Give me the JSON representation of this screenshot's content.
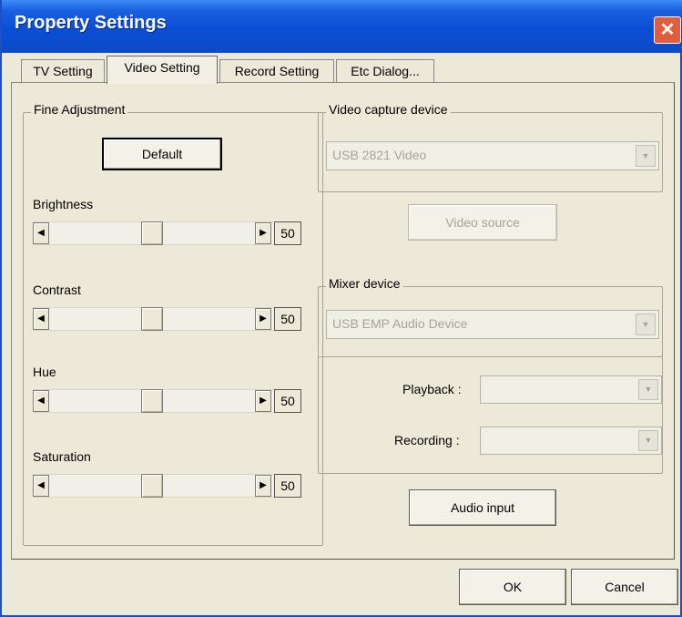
{
  "window": {
    "title": "Property Settings",
    "close_glyph": "✕"
  },
  "tabs": [
    {
      "label": "TV Setting"
    },
    {
      "label": "Video Setting",
      "active": true
    },
    {
      "label": "Record Setting"
    },
    {
      "label": "Etc Dialog..."
    }
  ],
  "fine_adjustment": {
    "legend": "Fine Adjustment",
    "default_button": "Default",
    "sliders": [
      {
        "label": "Brightness",
        "value": "50",
        "level": 0.5
      },
      {
        "label": "Contrast",
        "value": "50",
        "level": 0.5
      },
      {
        "label": "Hue",
        "value": "50",
        "level": 0.5
      },
      {
        "label": "Saturation",
        "value": "50",
        "level": 0.5
      }
    ]
  },
  "video_capture": {
    "legend": "Video capture device",
    "device": "USB 2821 Video",
    "source_button": "Video source"
  },
  "mixer": {
    "legend": "Mixer device",
    "device": "USB EMP Audio Device",
    "playback_label": "Playback :",
    "playback_value": "",
    "recording_label": "Recording :",
    "recording_value": "",
    "audio_input_button": "Audio input"
  },
  "footer": {
    "ok": "OK",
    "cancel": "Cancel"
  },
  "icons": {
    "left_arrow": "◀",
    "right_arrow": "▶",
    "combo_arrow": "▼"
  },
  "colors": {
    "titlebar": "#0a4ed6",
    "close": "#e35c3b",
    "face": "#ece9d8"
  }
}
